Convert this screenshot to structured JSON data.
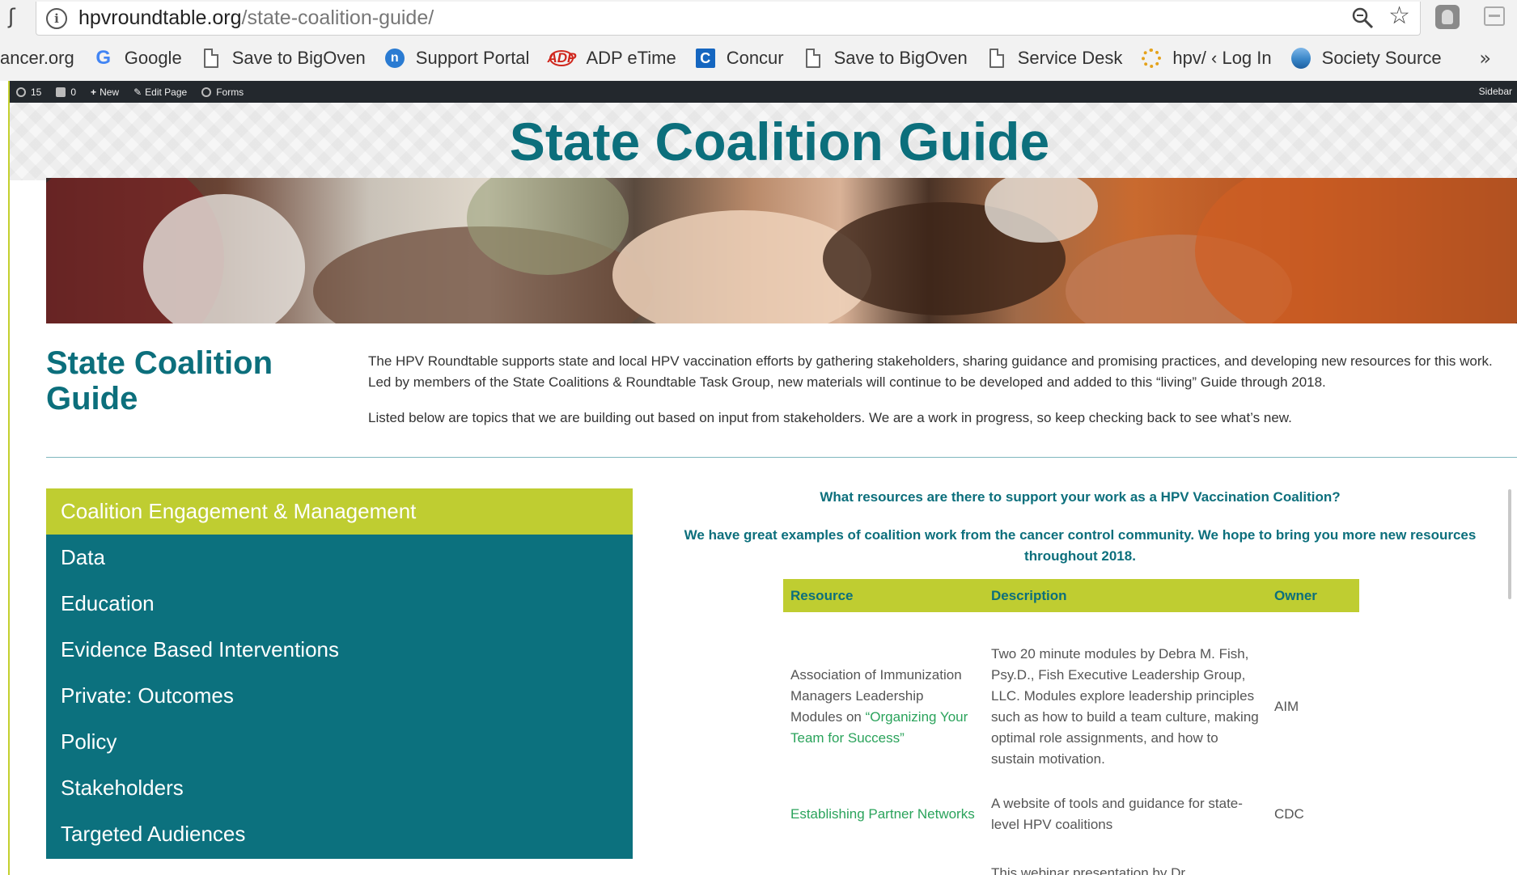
{
  "browser": {
    "back_fragment": "ʃ",
    "url_host": "hpvroundtable.org",
    "url_path": "/state-coalition-guide/",
    "bookmarks": [
      {
        "label": "ancer.org",
        "icon": "none"
      },
      {
        "label": "Google",
        "icon": "google-icon"
      },
      {
        "label": "Save to BigOven",
        "icon": "page-icon"
      },
      {
        "label": "Support Portal",
        "icon": "support-portal-icon"
      },
      {
        "label": "ADP eTime",
        "icon": "adp-icon"
      },
      {
        "label": "Concur",
        "icon": "concur-icon"
      },
      {
        "label": "Save to BigOven",
        "icon": "page-icon"
      },
      {
        "label": "Service Desk",
        "icon": "page-icon"
      },
      {
        "label": "hpv/ ‹ Log In",
        "icon": "hpv-icon"
      },
      {
        "label": "Society Source",
        "icon": "society-icon"
      }
    ],
    "more": "»"
  },
  "adminbar": {
    "count": "15",
    "comments": "0",
    "new_label": "New",
    "edit_label": "Edit Page",
    "forms_label": "Forms",
    "right_label": "Sidebar"
  },
  "page": {
    "title": "State Coalition Guide",
    "intro_title": "State Coalition Guide",
    "intro_p1": "The HPV Roundtable supports state and local HPV vaccination efforts by gathering stakeholders, sharing guidance and promising practices, and developing new resources for this work. Led by members of the State Coalitions & Roundtable Task Group, new materials will continue to be developed and added to this “living” Guide through 2018.",
    "intro_p2": "Listed below are topics that we are building out based on input from stakeholders. We are a work in progress, so keep checking back to see what’s new."
  },
  "menu": {
    "items": [
      "Coalition Engagement & Management",
      "Data",
      "Education",
      "Evidence Based Interventions",
      "Private: Outcomes",
      "Policy",
      "Stakeholders",
      "Targeted Audiences"
    ],
    "active_index": 0
  },
  "content": {
    "question": "What resources are there to support your work as a HPV Vaccination Coalition?",
    "subhead": "We have great examples of coalition work from the cancer control community.  We hope to bring you more new resources throughout 2018.",
    "table": {
      "headers": [
        "Resource",
        "Description",
        "Owner"
      ],
      "rows": [
        {
          "resource_pre": "Association of Immunization Managers Leadership Modules on ",
          "resource_link": "“Organizing Your Team for Success”",
          "description": "Two 20 minute modules by Debra M. Fish, Psy.D., Fish Executive Leadership Group, LLC.  Modules explore leadership principles such as how to build a team culture, making optimal role assignments, and how to sustain motivation.",
          "owner": "AIM"
        },
        {
          "resource_link": "Establishing Partner Networks",
          "description": " A website of tools and guidance for state-level HPV coalitions",
          "owner": "CDC"
        },
        {
          "description": "This webinar presentation by Dr"
        }
      ]
    }
  },
  "colors": {
    "teal": "#0c717e",
    "lime": "#bfcd31",
    "link_green": "#2aa35b"
  }
}
